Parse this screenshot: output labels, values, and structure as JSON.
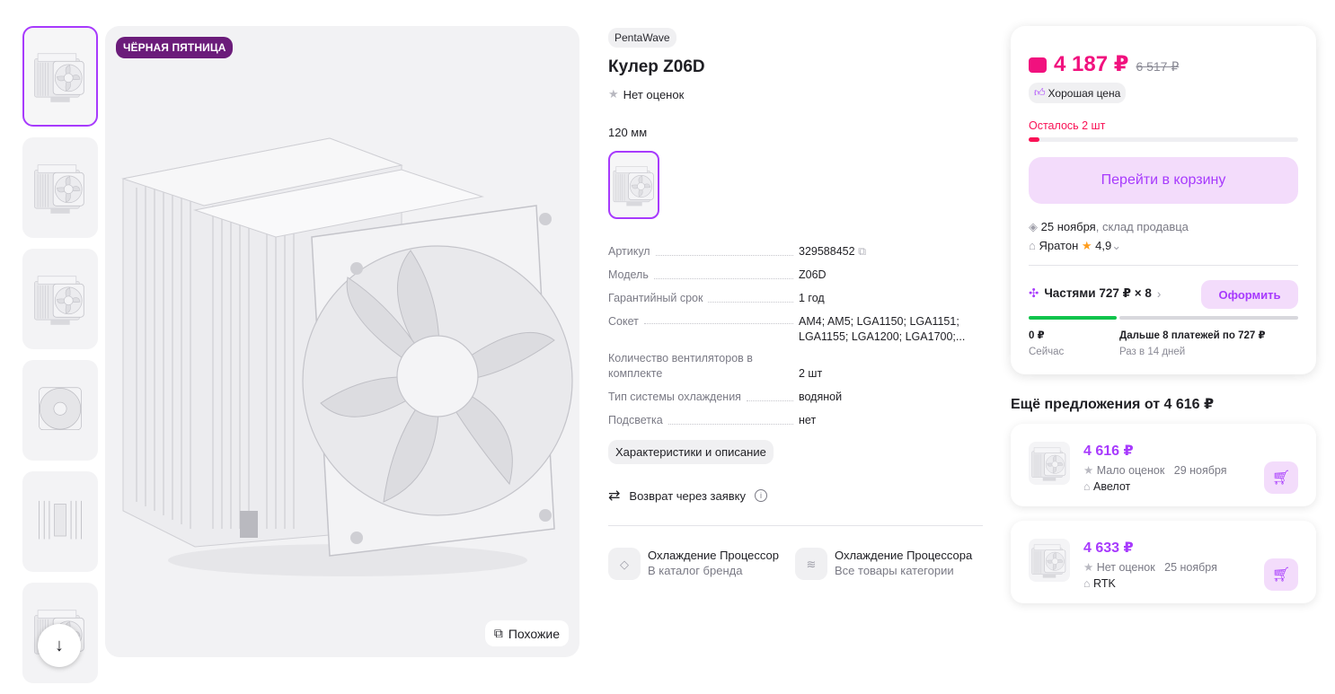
{
  "gallery": {
    "badge": "ЧЁРНАЯ ПЯТНИЦА",
    "similar_label": "Похожие"
  },
  "product": {
    "brand": "PentaWave",
    "title": "Кулер Z06D",
    "rating_text": "Нет оценок",
    "size_label": "120 мм",
    "specs": [
      {
        "key": "Артикул",
        "value": "329588452"
      },
      {
        "key": "Модель",
        "value": "Z06D"
      },
      {
        "key": "Гарантийный срок",
        "value": "1 год"
      },
      {
        "key": "Сокет",
        "value": "AM4; AM5; LGA1150; LGA1151; LGA1155; LGA1200; LGA1700;..."
      },
      {
        "key": "Количество вентиляторов в комплекте",
        "value": "2 шт"
      },
      {
        "key": "Тип системы охлаждения",
        "value": "водяной"
      },
      {
        "key": "Подсветка",
        "value": "нет"
      }
    ],
    "characteristics_button": "Характеристики и описание",
    "return_text": "Возврат через заявку",
    "catalog_links": [
      {
        "title": "Охлаждение Процессор",
        "subtitle": "В каталог бренда"
      },
      {
        "title": "Охлаждение Процессора",
        "subtitle": "Все товары категории"
      }
    ]
  },
  "buy_card": {
    "price": "4 187 ₽",
    "old_price": "6 517 ₽",
    "good_price_label": "Хорошая цена",
    "stock_text": "Осталось 2 шт",
    "stock_level": 0.04,
    "cart_button": "Перейти в корзину",
    "delivery_date": "25 ноября",
    "delivery_source": ", склад продавца",
    "seller": "Яратон",
    "seller_rating": "4,9",
    "installments_label": "Частями 727 ₽ × 8",
    "installments_button": "Оформить",
    "now_amount": "0 ₽",
    "now_label": "Сейчас",
    "later_text": "Дальше 8 платежей по 727 ₽",
    "later_label": "Раз в 14 дней"
  },
  "more_offers": {
    "title": "Ещё предложения от 4 616 ₽",
    "items": [
      {
        "price": "4 616 ₽",
        "rating": "Мало оценок",
        "date": "29 ноября",
        "seller": "Авелот"
      },
      {
        "price": "4 633 ₽",
        "rating": "Нет оценок",
        "date": "25 ноября",
        "seller": "RTK"
      }
    ]
  },
  "colors": {
    "accent": "#a73afd",
    "price": "#f1117e",
    "badge": "#6b1c7a",
    "stock": "#f91155"
  }
}
